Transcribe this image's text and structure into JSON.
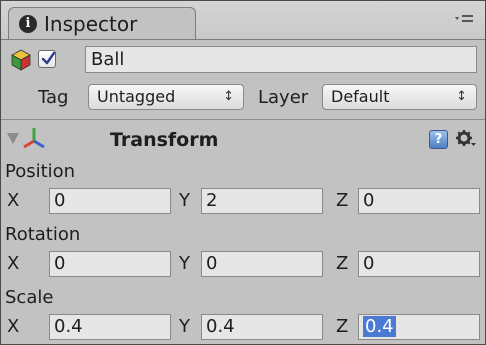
{
  "inspector": {
    "tab_title": "Inspector",
    "object": {
      "name": "Ball",
      "active": true
    },
    "tag_label": "Tag",
    "tag_value": "Untagged",
    "layer_label": "Layer",
    "layer_value": "Default",
    "dropdown_arrow": "↕"
  },
  "transform": {
    "title": "Transform",
    "help_glyph": "?",
    "position": {
      "label": "Position",
      "x": "0",
      "y": "2",
      "z": "0"
    },
    "rotation": {
      "label": "Rotation",
      "x": "0",
      "y": "0",
      "z": "0"
    },
    "scale": {
      "label": "Scale",
      "x": "0.4",
      "y": "0.4",
      "z": "0.4"
    },
    "axes": {
      "x": "X",
      "y": "Y",
      "z": "Z"
    }
  },
  "icons": {
    "tab": "info-icon",
    "menu": "menu-icon",
    "object": "cube-icon",
    "active": "checkbox-icon",
    "transform": "transform-axes-icon",
    "help": "help-icon",
    "settings": "gear-icon"
  },
  "colors": {
    "panel_bg": "#c2c2c2",
    "field_bg": "#e6e6e6",
    "selection": "#4b7ad3"
  }
}
